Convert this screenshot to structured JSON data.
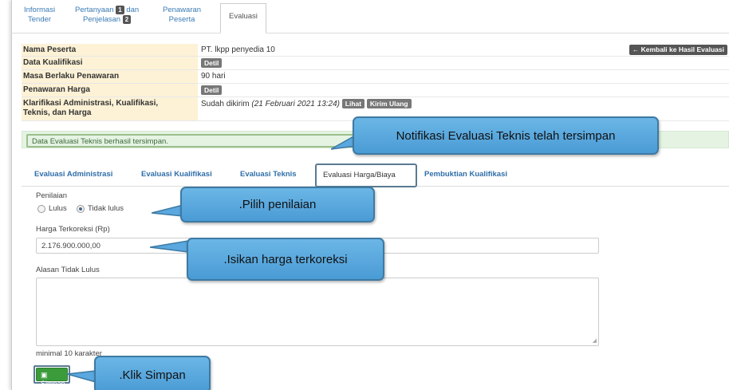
{
  "top_tabs": [
    {
      "line1": "Informasi",
      "line2": "Tender"
    },
    {
      "line1": "Pertanyaan",
      "num1": "1",
      "line1b": "dan",
      "line2": "Penjelasan",
      "num2": "2"
    },
    {
      "line1": "Penawaran",
      "line2": "Peserta"
    },
    {
      "label": "Evaluasi"
    }
  ],
  "info": {
    "nama_peserta": {
      "label": "Nama Peserta",
      "value": "PT. lkpp penyedia 10"
    },
    "back_button": "← Kembali ke Hasil Evaluasi",
    "data_kualifikasi": {
      "label": "Data Kualifikasi",
      "badge": "Detil"
    },
    "masa_berlaku": {
      "label": "Masa Berlaku Penawaran",
      "value": "90 hari"
    },
    "penawaran_harga": {
      "label": "Penawaran Harga",
      "badge": "Detil"
    },
    "klarifikasi": {
      "label_line1": "Klarifikasi Administrasi, Kualifikasi,",
      "label_line2": "Teknis, dan Harga",
      "value": "Sudah dikirim",
      "date": "(21 Februari 2021 13:24)",
      "badge1": "Lihat",
      "badge2": "Kirim Ulang"
    }
  },
  "notice": "Data Evaluasi Teknis berhasil tersimpan.",
  "eval_tabs": [
    "Evaluasi Administrasi",
    "Evaluasi Kualifikasi",
    "Evaluasi Teknis",
    "Evaluasi Harga/Biaya",
    "Pembuktian Kualifikasi"
  ],
  "form": {
    "penilaian_label": "Penilaian",
    "lulus": "Lulus",
    "tidak_lulus": "Tidak lulus",
    "harga_label": "Harga Terkoreksi (Rp)",
    "harga_value": "2.176.900.000,00",
    "alasan_label": "Alasan Tidak Lulus",
    "min_note": "minimal 10 karakter",
    "save": "Simpan"
  },
  "callouts": {
    "notifikasi": "Notifikasi Evaluasi Teknis telah tersimpan",
    "pilih": ".Pilih penilaian",
    "isikan": ".Isikan harga terkoreksi",
    "klik": ".Klik Simpan"
  },
  "colors": {
    "callout": "#5aa8df",
    "label_bg": "#fdf2d6",
    "notice_bg": "#e5f3e3",
    "tab_blue": "#2f6ea8",
    "save_green": "#3b9b3b"
  }
}
